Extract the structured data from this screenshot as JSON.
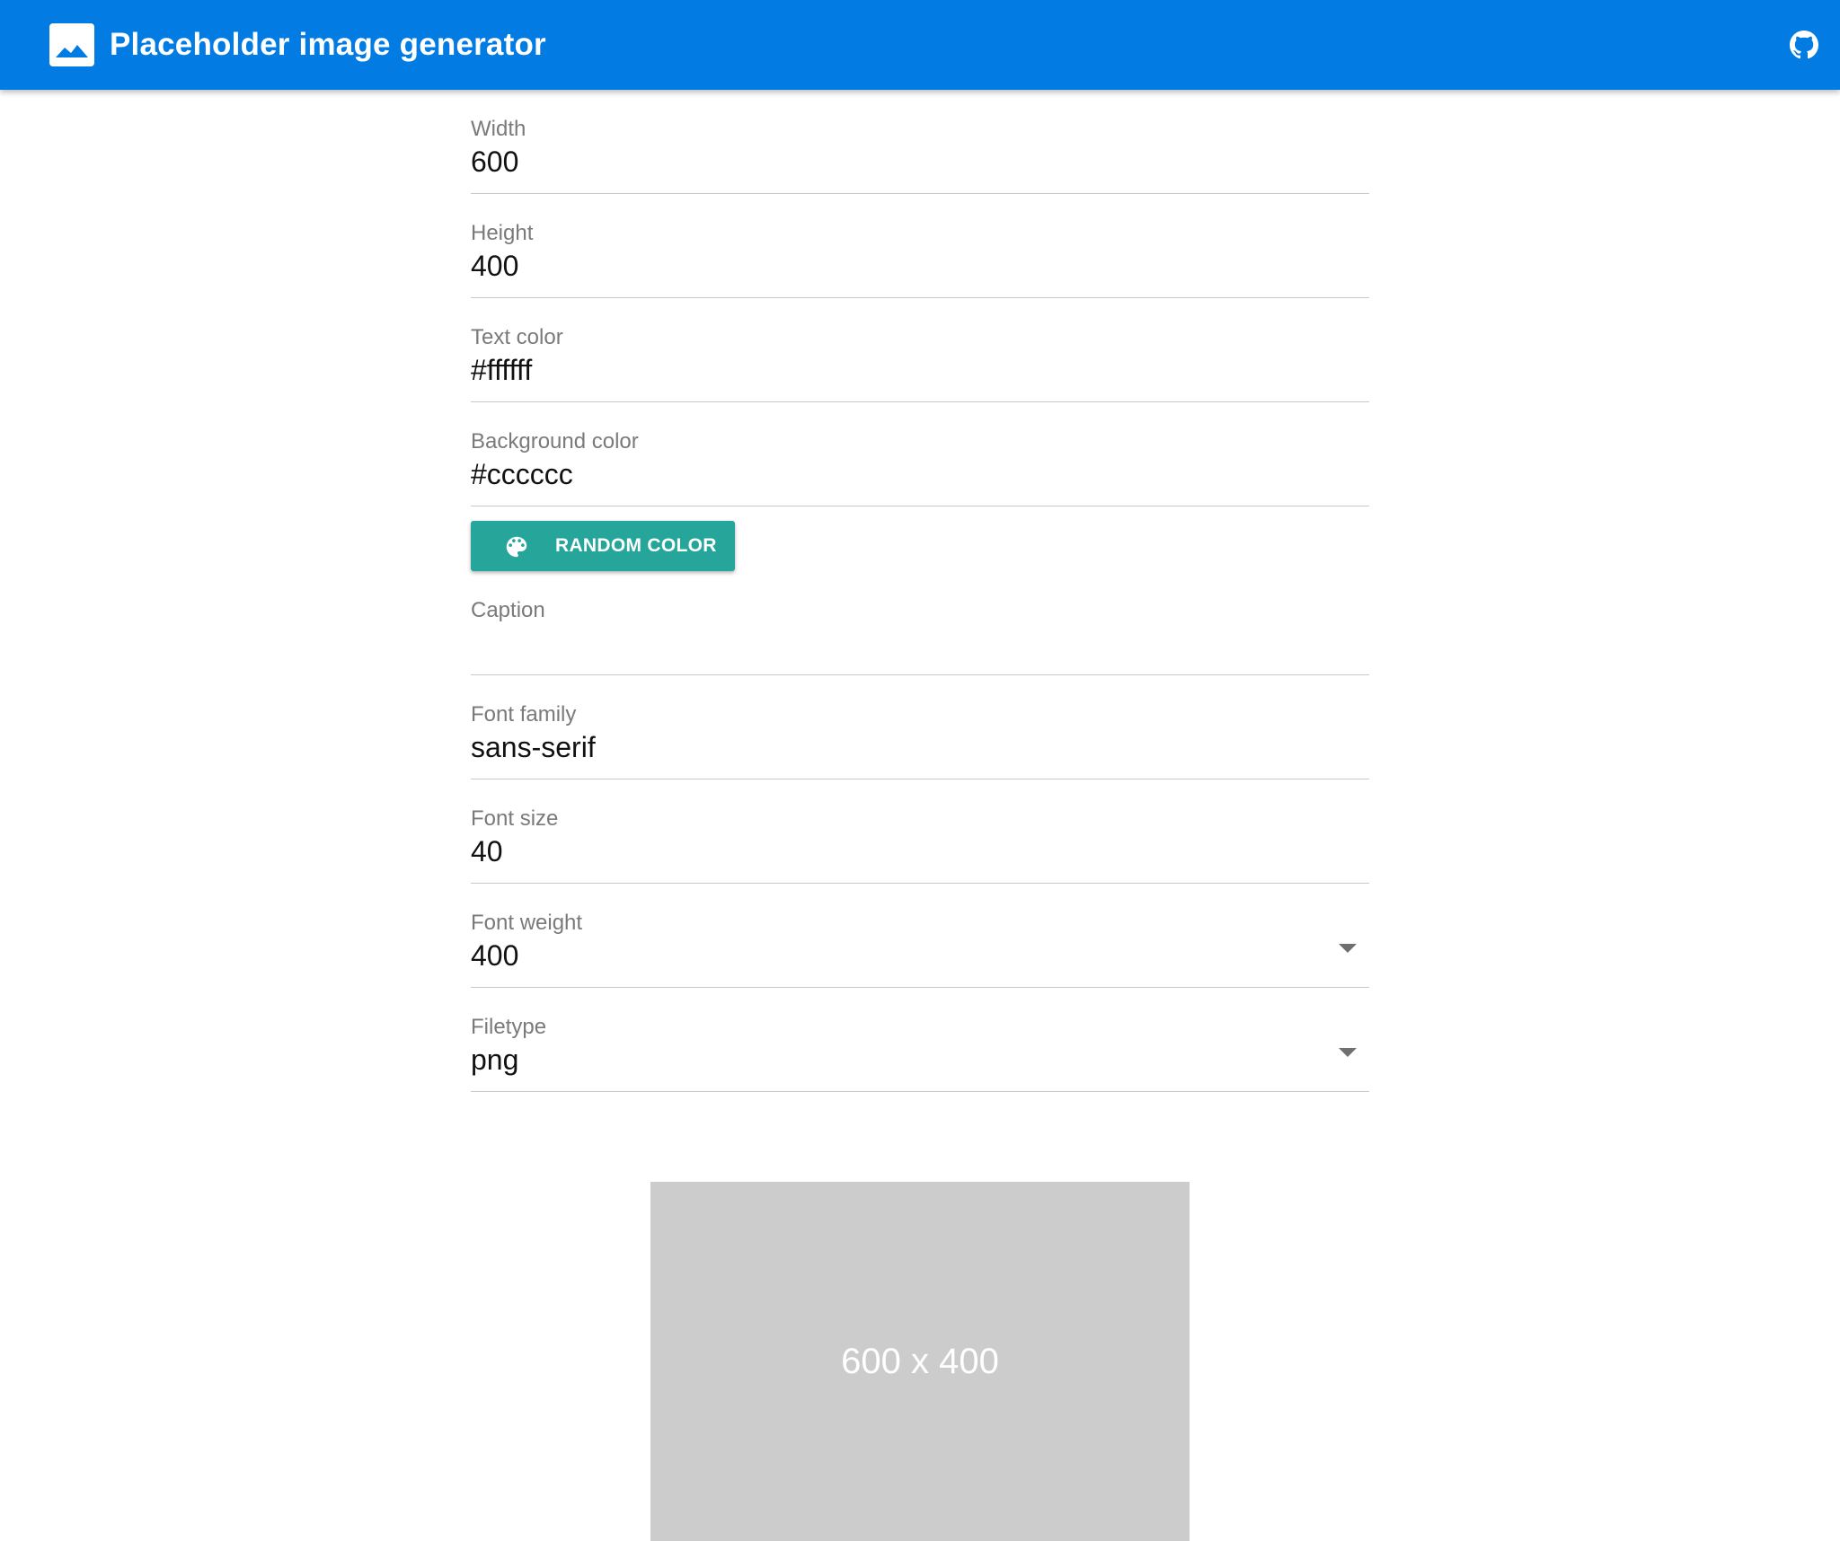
{
  "header": {
    "title": "Placeholder image generator",
    "logo_icon": "image-icon",
    "github_icon": "github-icon",
    "bg_color": "#027be3"
  },
  "form": {
    "width": {
      "label": "Width",
      "value": "600"
    },
    "height": {
      "label": "Height",
      "value": "400"
    },
    "text_color": {
      "label": "Text color",
      "value": "#ffffff"
    },
    "background_color": {
      "label": "Background color",
      "value": "#cccccc"
    },
    "random_color_button": {
      "label": "RANDOM COLOR",
      "icon": "palette-icon",
      "color": "#26a69a"
    },
    "caption": {
      "label": "Caption",
      "value": ""
    },
    "font_family": {
      "label": "Font family",
      "value": "sans-serif"
    },
    "font_size": {
      "label": "Font size",
      "value": "40"
    },
    "font_weight": {
      "label": "Font weight",
      "value": "400"
    },
    "filetype": {
      "label": "Filetype",
      "value": "png"
    }
  },
  "preview": {
    "text": "600 x 400",
    "bg_color": "#cccccc",
    "text_color": "#ffffff"
  }
}
